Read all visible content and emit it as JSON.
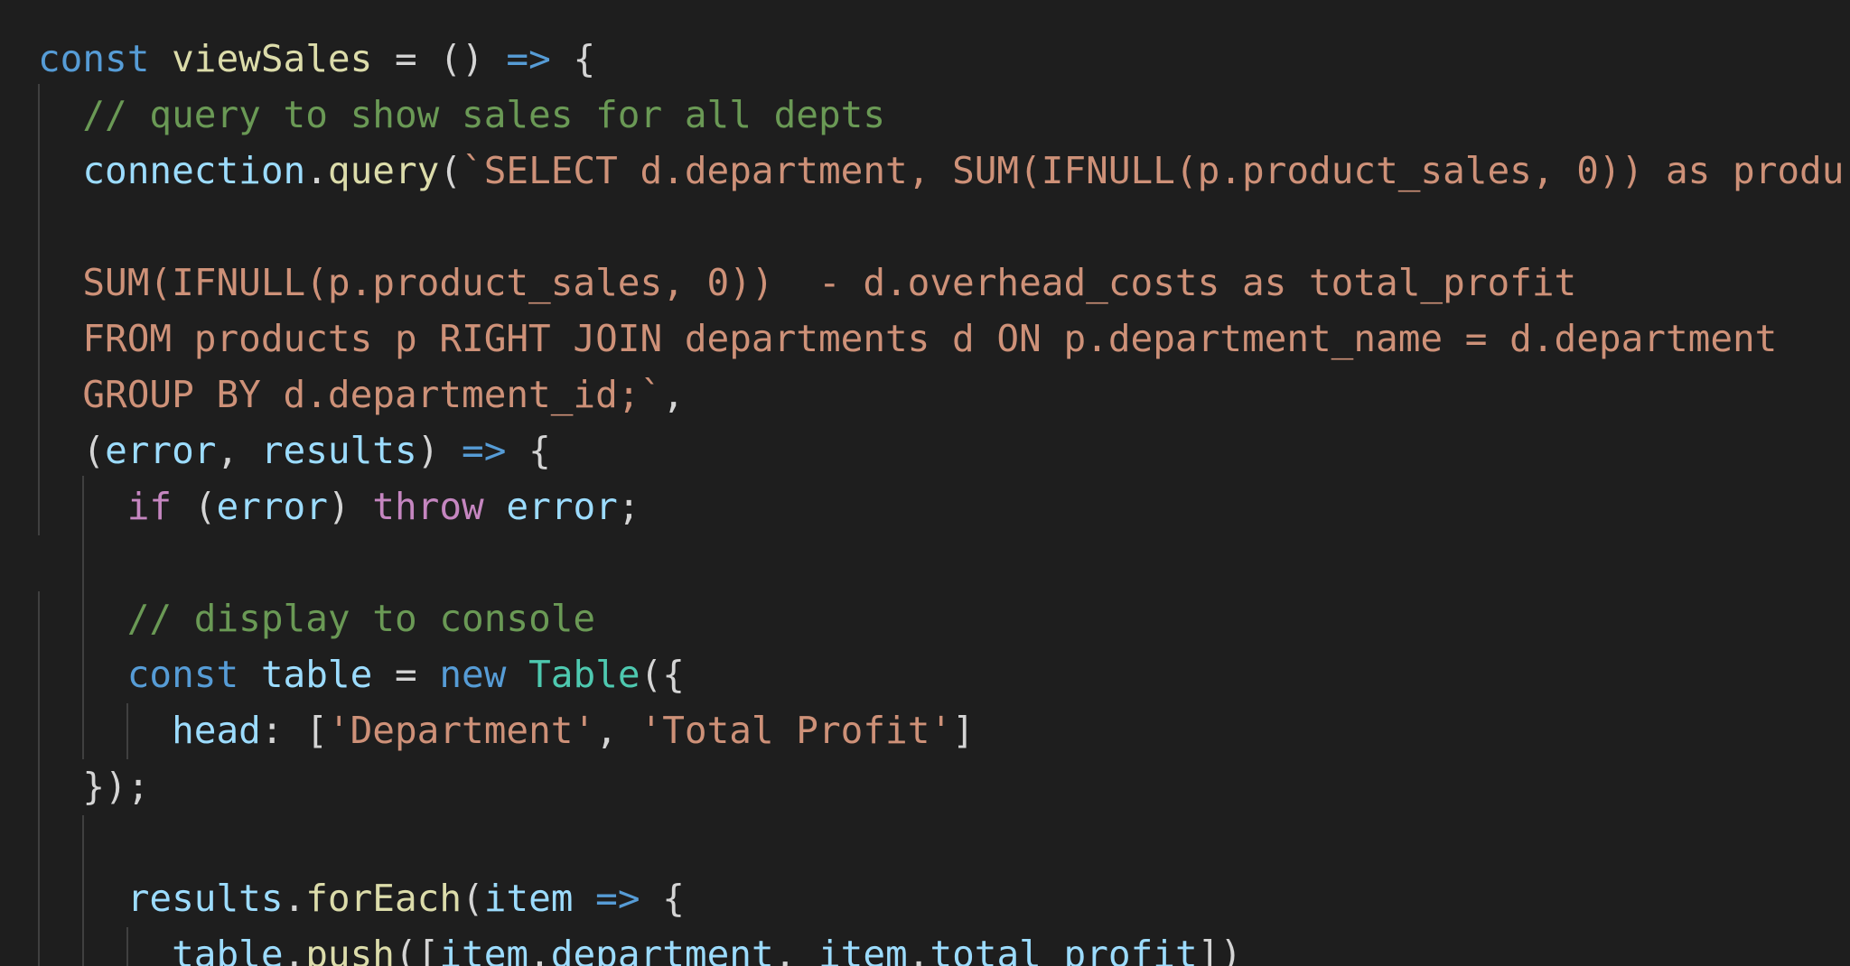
{
  "editor": {
    "lines": [
      {
        "tokens": [
          {
            "text": "const",
            "kind": "keyword"
          },
          {
            "text": " ",
            "kind": "punct"
          },
          {
            "text": "viewSales",
            "kind": "function"
          },
          {
            "text": " = () ",
            "kind": "punct"
          },
          {
            "text": "=>",
            "kind": "keyword"
          },
          {
            "text": " {",
            "kind": "punct"
          }
        ]
      },
      {
        "tokens": [
          {
            "text": "  ",
            "kind": "punct"
          },
          {
            "text": "// query to show sales for all depts",
            "kind": "comment"
          }
        ]
      },
      {
        "tokens": [
          {
            "text": "  ",
            "kind": "punct"
          },
          {
            "text": "connection",
            "kind": "variable"
          },
          {
            "text": ".",
            "kind": "punct"
          },
          {
            "text": "query",
            "kind": "function"
          },
          {
            "text": "(",
            "kind": "punct"
          },
          {
            "text": "`SELECT d.department, SUM(IFNULL(p.product_sales, 0)) as produ",
            "kind": "string"
          }
        ]
      },
      {
        "tokens": []
      },
      {
        "tokens": [
          {
            "text": "  ",
            "kind": "punct"
          },
          {
            "text": "SUM(IFNULL(p.product_sales, 0))  - d.overhead_costs as total_profit",
            "kind": "string"
          }
        ]
      },
      {
        "tokens": [
          {
            "text": "  ",
            "kind": "punct"
          },
          {
            "text": "FROM products p RIGHT JOIN departments d ON p.department_name = d.department",
            "kind": "string"
          }
        ]
      },
      {
        "tokens": [
          {
            "text": "  ",
            "kind": "punct"
          },
          {
            "text": "GROUP BY d.department_id;`",
            "kind": "string"
          },
          {
            "text": ",",
            "kind": "punct"
          }
        ]
      },
      {
        "tokens": [
          {
            "text": "  (",
            "kind": "punct"
          },
          {
            "text": "error",
            "kind": "variable"
          },
          {
            "text": ", ",
            "kind": "punct"
          },
          {
            "text": "results",
            "kind": "variable"
          },
          {
            "text": ") ",
            "kind": "punct"
          },
          {
            "text": "=>",
            "kind": "keyword"
          },
          {
            "text": " {",
            "kind": "punct"
          }
        ]
      },
      {
        "tokens": [
          {
            "text": "    ",
            "kind": "punct"
          },
          {
            "text": "if",
            "kind": "control"
          },
          {
            "text": " (",
            "kind": "punct"
          },
          {
            "text": "error",
            "kind": "variable"
          },
          {
            "text": ") ",
            "kind": "punct"
          },
          {
            "text": "throw",
            "kind": "control"
          },
          {
            "text": " ",
            "kind": "punct"
          },
          {
            "text": "error",
            "kind": "variable"
          },
          {
            "text": ";",
            "kind": "punct"
          }
        ]
      },
      {
        "tokens": []
      },
      {
        "tokens": [
          {
            "text": "    ",
            "kind": "punct"
          },
          {
            "text": "// display to console",
            "kind": "comment"
          }
        ]
      },
      {
        "tokens": [
          {
            "text": "    ",
            "kind": "punct"
          },
          {
            "text": "const",
            "kind": "keyword"
          },
          {
            "text": " ",
            "kind": "punct"
          },
          {
            "text": "table",
            "kind": "variable"
          },
          {
            "text": " = ",
            "kind": "punct"
          },
          {
            "text": "new",
            "kind": "keyword"
          },
          {
            "text": " ",
            "kind": "punct"
          },
          {
            "text": "Table",
            "kind": "class"
          },
          {
            "text": "({",
            "kind": "punct"
          }
        ]
      },
      {
        "tokens": [
          {
            "text": "      ",
            "kind": "punct"
          },
          {
            "text": "head",
            "kind": "variable"
          },
          {
            "text": ": [",
            "kind": "punct"
          },
          {
            "text": "'Department'",
            "kind": "string"
          },
          {
            "text": ", ",
            "kind": "punct"
          },
          {
            "text": "'Total Profit'",
            "kind": "string"
          },
          {
            "text": "]",
            "kind": "punct"
          }
        ]
      },
      {
        "tokens": [
          {
            "text": "  });",
            "kind": "punct"
          }
        ]
      },
      {
        "tokens": []
      },
      {
        "tokens": [
          {
            "text": "    ",
            "kind": "punct"
          },
          {
            "text": "results",
            "kind": "variable"
          },
          {
            "text": ".",
            "kind": "punct"
          },
          {
            "text": "forEach",
            "kind": "function"
          },
          {
            "text": "(",
            "kind": "punct"
          },
          {
            "text": "item",
            "kind": "variable"
          },
          {
            "text": " ",
            "kind": "punct"
          },
          {
            "text": "=>",
            "kind": "keyword"
          },
          {
            "text": " {",
            "kind": "punct"
          }
        ]
      },
      {
        "tokens": [
          {
            "text": "      ",
            "kind": "punct"
          },
          {
            "text": "table",
            "kind": "variable"
          },
          {
            "text": ".",
            "kind": "punct"
          },
          {
            "text": "push",
            "kind": "function"
          },
          {
            "text": "([",
            "kind": "punct"
          },
          {
            "text": "item",
            "kind": "variable"
          },
          {
            "text": ".",
            "kind": "punct"
          },
          {
            "text": "department",
            "kind": "variable"
          },
          {
            "text": ", ",
            "kind": "punct"
          },
          {
            "text": "item",
            "kind": "variable"
          },
          {
            "text": ".",
            "kind": "punct"
          },
          {
            "text": "total_profit",
            "kind": "variable"
          },
          {
            "text": "])",
            "kind": "punct"
          }
        ]
      }
    ]
  },
  "theme": {
    "background": "#1e1e1e",
    "keyword": "#569cd6",
    "control": "#c586c0",
    "function": "#dcdcaa",
    "variable": "#9cdcfe",
    "string": "#ce9178",
    "class": "#4ec9b0",
    "comment": "#6a9955",
    "punct": "#d4d4d4",
    "indent_guide": "#404040"
  }
}
